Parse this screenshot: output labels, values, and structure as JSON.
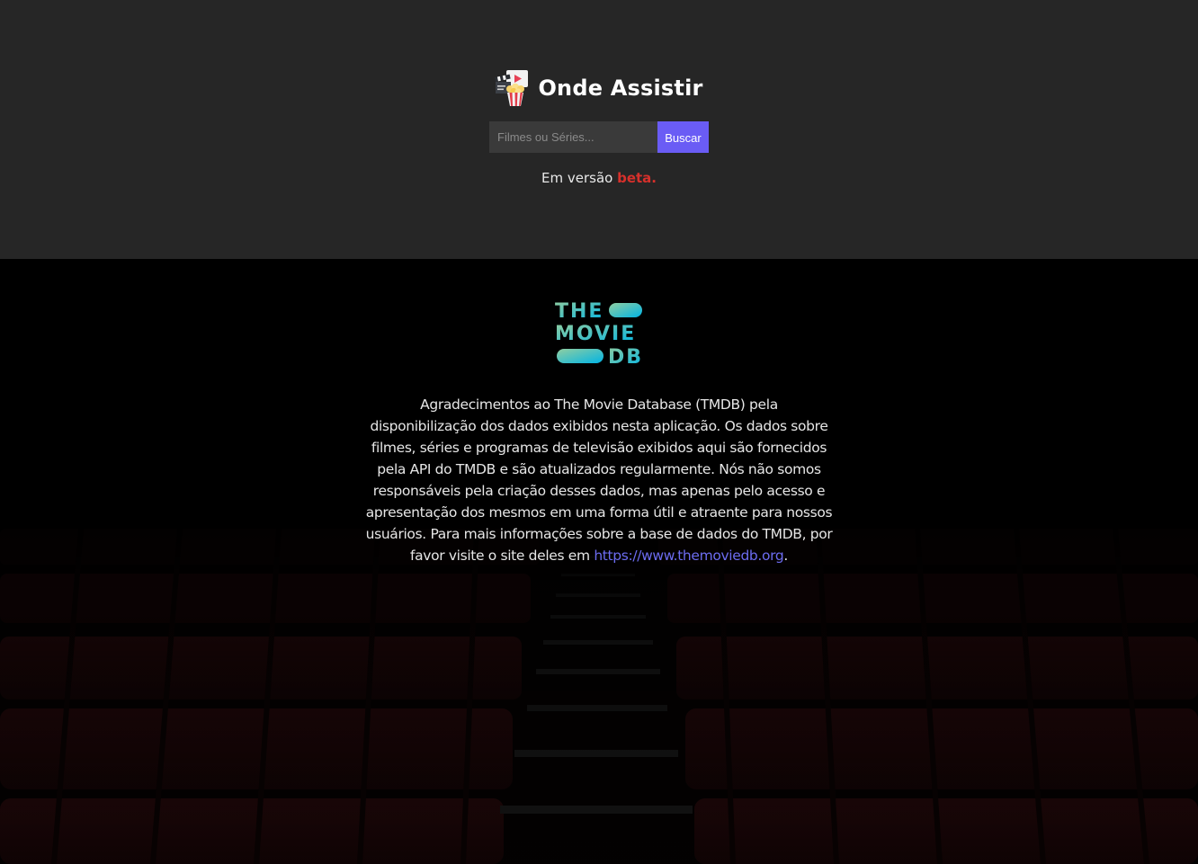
{
  "header": {
    "title": "Onde Assistir",
    "logo_icon": "clapperboard-popcorn-icon",
    "search": {
      "placeholder": "Filmes ou Séries...",
      "value": "",
      "button_label": "Buscar"
    },
    "beta": {
      "prefix": "Em versão ",
      "highlight": "beta."
    }
  },
  "footer": {
    "logo": {
      "name": "tmdb-logo",
      "text": "THE MOVIE DB"
    },
    "credits": {
      "text": "Agradecimentos ao The Movie Database (TMDB) pela disponibilização dos dados exibidos nesta aplicação. Os dados sobre filmes, séries e programas de televisão exibidos aqui são fornecidos pela API do TMDB e são atualizados regularmente. Nós não somos responsáveis pela criação desses dados, mas apenas pelo acesso e apresentação dos mesmos em uma forma útil e atraente para nossos usuários. Para mais informações sobre a base de dados do TMDB, por favor visite o site deles em ",
      "link_text": "https://www.themoviedb.org",
      "suffix": "."
    },
    "background": "movie-theater-seats"
  },
  "colors": {
    "header_bg": "#262626",
    "page_bg": "#000000",
    "accent": "#6a5cf5",
    "beta": "#d6302b",
    "link": "#6c6cf0"
  }
}
